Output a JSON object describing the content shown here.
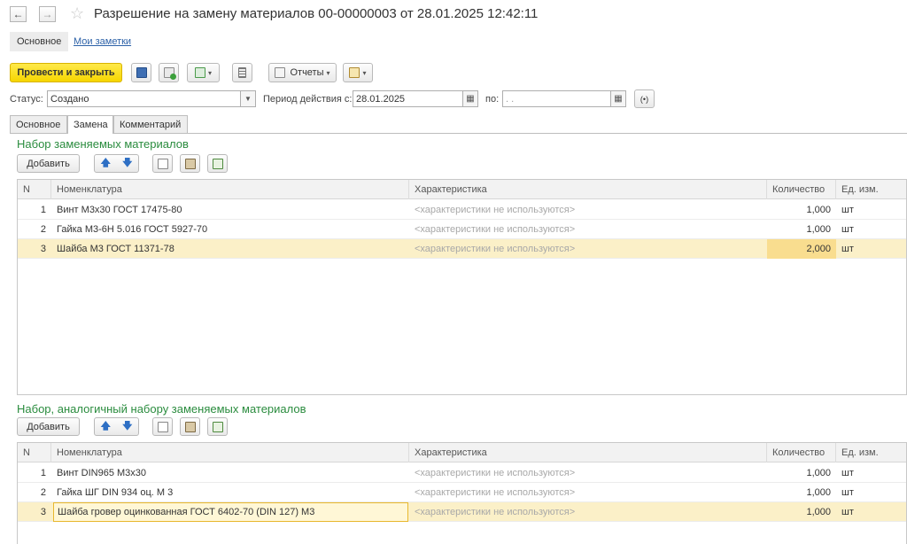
{
  "window": {
    "title": "Разрешение на замену материалов 00-00000003 от 28.01.2025 12:42:11"
  },
  "subnav": {
    "main": "Основное",
    "notes": "Мои заметки"
  },
  "toolbar": {
    "post_close": "Провести и закрыть",
    "reports": "Отчеты"
  },
  "fields": {
    "status_label": "Статус:",
    "status_value": "Создано",
    "period_from_label": "Период действия с:",
    "period_from_value": "28.01.2025",
    "period_to_label": "по:",
    "period_to_value": " .  ."
  },
  "tabs": [
    "Основное",
    "Замена",
    "Комментарий"
  ],
  "group1": {
    "title": "Набор заменяемых материалов",
    "add": "Добавить",
    "columns": [
      "N",
      "Номенклатура",
      "Характеристика",
      "Количество",
      "Ед. изм."
    ],
    "rows": [
      {
        "n": "1",
        "name": "Винт М3х30 ГОСТ 17475-80",
        "char": "<характеристики не используются>",
        "qty": "1,000",
        "unit": "шт"
      },
      {
        "n": "2",
        "name": "Гайка М3-6H 5.016 ГОСТ 5927-70",
        "char": "<характеристики не используются>",
        "qty": "1,000",
        "unit": "шт"
      },
      {
        "n": "3",
        "name": "Шайба М3 ГОСТ 11371-78",
        "char": "<характеристики не используются>",
        "qty": "2,000",
        "unit": "шт"
      }
    ]
  },
  "group2": {
    "title": "Набор, аналогичный набору заменяемых материалов",
    "add": "Добавить",
    "columns": [
      "N",
      "Номенклатура",
      "Характеристика",
      "Количество",
      "Ед. изм."
    ],
    "rows": [
      {
        "n": "1",
        "name": "Винт DIN965 M3x30",
        "char": "<характеристики не используются>",
        "qty": "1,000",
        "unit": "шт"
      },
      {
        "n": "2",
        "name": "Гайка ШГ DIN 934 оц. М 3",
        "char": "<характеристики не используются>",
        "qty": "1,000",
        "unit": "шт"
      },
      {
        "n": "3",
        "name": "Шайба гровер оцинкованная ГОСТ 6402-70 (DIN 127) М3",
        "char": "<характеристики не используются>",
        "qty": "1,000",
        "unit": "шт"
      }
    ]
  }
}
